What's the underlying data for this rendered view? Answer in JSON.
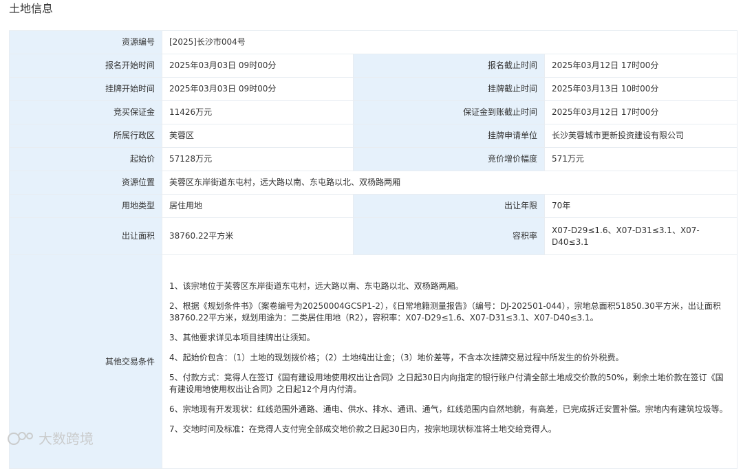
{
  "page_title": "土地信息",
  "rows": {
    "resource_no": {
      "label": "资源编号",
      "value": "[2025]长沙市004号"
    },
    "reg_start": {
      "label": "报名开始时间",
      "value": "2025年03月03日 09时00分"
    },
    "reg_end": {
      "label": "报名截止时间",
      "value": "2025年03月12日 17时00分"
    },
    "list_start": {
      "label": "挂牌开始时间",
      "value": "2025年03月03日 09时00分"
    },
    "list_end": {
      "label": "挂牌截止时间",
      "value": "2025年03月13日 10时00分"
    },
    "deposit": {
      "label": "竞买保证金",
      "value": "11426万元"
    },
    "deposit_deadline": {
      "label": "保证金到账截止时间",
      "value": "2025年03月12日 17时00分"
    },
    "district": {
      "label": "所属行政区",
      "value": "芙蓉区"
    },
    "applicant": {
      "label": "挂牌申请单位",
      "value": "长沙芙蓉城市更新投资建设有限公司"
    },
    "start_price": {
      "label": "起始价",
      "value": "57128万元"
    },
    "increment": {
      "label": "竞价增价幅度",
      "value": "571万元"
    },
    "location": {
      "label": "资源位置",
      "value": "芙蓉区东岸街道东屯村，远大路以南、东屯路以北、双杨路两厢"
    },
    "land_use": {
      "label": "用地类型",
      "value": "居住用地"
    },
    "term": {
      "label": "出让年限",
      "value": "70年"
    },
    "area": {
      "label": "出让面积",
      "value": "38760.22平方米"
    },
    "far": {
      "label": "容积率",
      "value": "X07-D29≤1.6、X07-D31≤3.1、X07-D40≤3.1"
    },
    "other": {
      "label": "其他交易条件"
    }
  },
  "conditions": [
    "1、该宗地位于芙蓉区东岸街道东屯村，远大路以南、东屯路以北、双杨路两厢。",
    "2、根据《规划条件书》（案卷编号为20250004GCSP1-2），《日常地籍测量报告》（编号：DJ-202501-044），宗地总面积51850.30平方米，出让面积38760.22平方米，规划用途为：二类居住用地（R2），容积率：X07-D29≤1.6、X07-D31≤3.1、X07-D40≤3.1。",
    "3、其他要求详见本项目挂牌出让须知。",
    "4、起始价包含：（1）土地的现划拨价格；（2）土地纯出让金；（3）地价差等，不含本次挂牌交易过程中所发生的价外税费。",
    "5、付款方式：竞得人在签订《国有建设用地使用权出让合同》之日起30日内向指定的银行账户付清全部土地成交价款的50%，剩余土地价款在签订《国有建设用地使用权出让合同》之日起12个月内付清。",
    "6、宗地现有开发现状：红线范围外通路、通电、供水、排水、通讯、通气，红线范围内自然地貌，有高差，已完成拆迁安置补偿。宗地内有建筑垃圾等。",
    "7、交地时间及标准：在竞得人支付完全部成交地价款之日起30日内，按宗地现状标准将土地交给竞得人。"
  ],
  "watermark": "大数跨境"
}
